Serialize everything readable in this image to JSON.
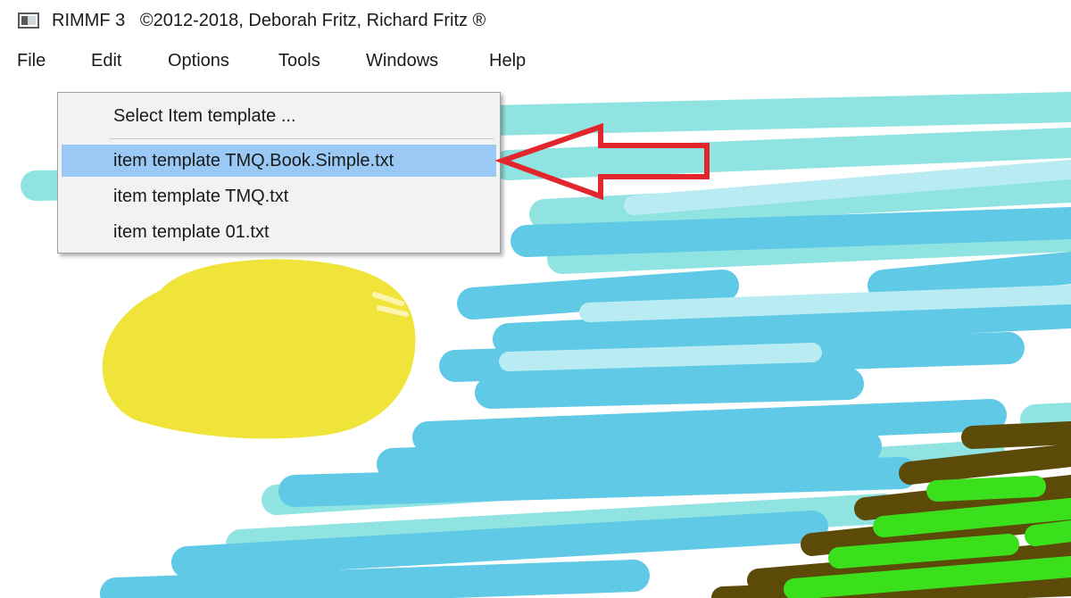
{
  "window": {
    "title": "RIMMF 3   ©2012-2018, Deborah Fritz, Richard Fritz ®",
    "icon": "app-window-icon"
  },
  "menubar": {
    "items": [
      "File",
      "Edit",
      "Options",
      "Tools",
      "Windows",
      "Help"
    ]
  },
  "dropdown": {
    "header_item": "Select Item template ...",
    "items": [
      {
        "label": "item template TMQ.Book.Simple.txt",
        "selected": true
      },
      {
        "label": "item template TMQ.txt",
        "selected": false
      },
      {
        "label": "item template 01.txt",
        "selected": false
      }
    ]
  },
  "annotation": {
    "arrow_color": "#e3262d",
    "points_to": "item template TMQ.Book.Simple.txt"
  },
  "colors": {
    "selection": "#99c9f4",
    "menu_bg": "#f2f2f2",
    "sky_cyan": "#8fe3e0",
    "sky_blue": "#5fc9e6",
    "sun_yellow": "#f0e43a",
    "hill_brown": "#5c4a08",
    "grass_green": "#3be01c"
  }
}
